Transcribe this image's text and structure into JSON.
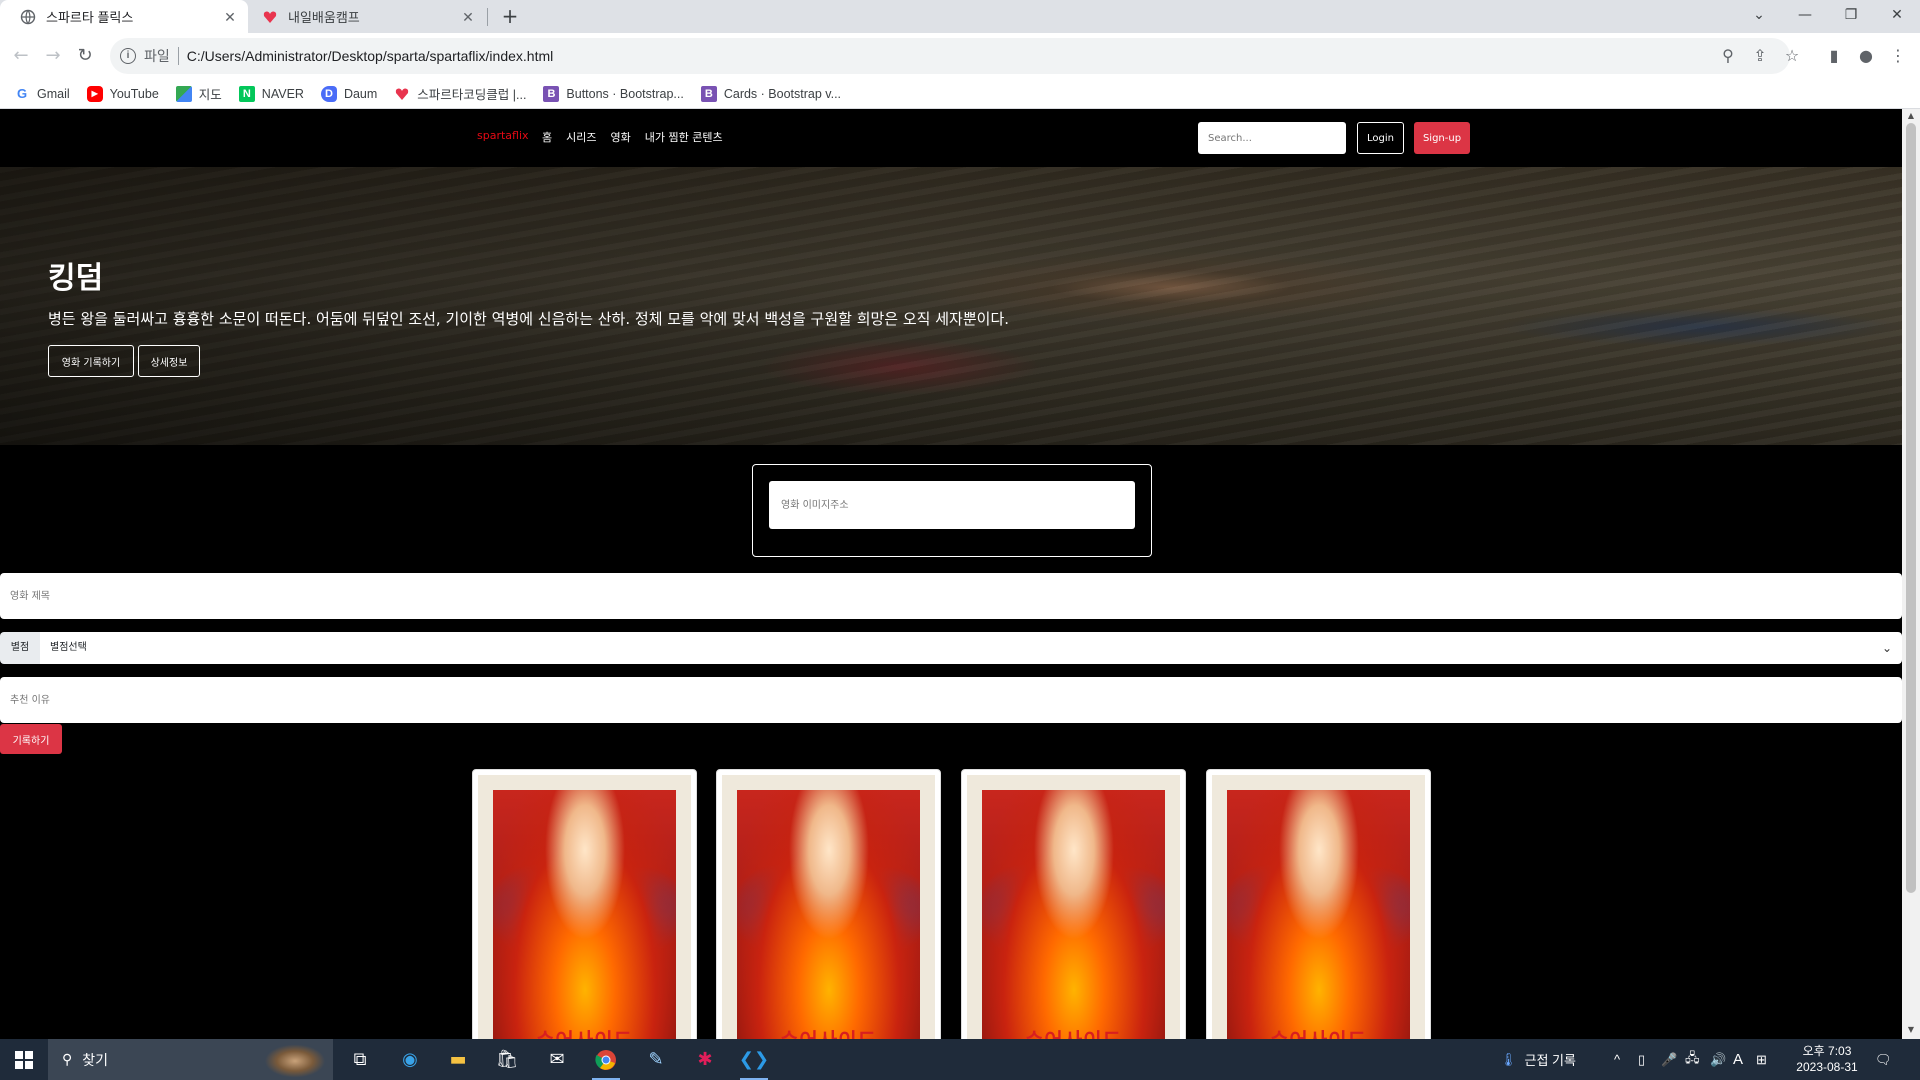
{
  "browser": {
    "tabs": [
      {
        "title": "스파르타 플릭스",
        "active": true
      },
      {
        "title": "내일배움캠프",
        "active": false
      }
    ],
    "scheme_label": "파일",
    "url": "C:/Users/Administrator/Desktop/sparta/spartaflix/index.html",
    "bookmarks": [
      {
        "label": "Gmail",
        "icon": "gmail-icon"
      },
      {
        "label": "YouTube",
        "icon": "youtube-icon"
      },
      {
        "label": "지도",
        "icon": "maps-icon"
      },
      {
        "label": "NAVER",
        "icon": "naver-icon"
      },
      {
        "label": "Daum",
        "icon": "daum-icon"
      },
      {
        "label": "스파르타코딩클럽 |...",
        "icon": "sparta-icon"
      },
      {
        "label": "Buttons · Bootstrap...",
        "icon": "bootstrap-icon"
      },
      {
        "label": "Cards · Bootstrap v...",
        "icon": "bootstrap-icon"
      }
    ]
  },
  "site": {
    "brand": "spartaflix",
    "nav": [
      "홈",
      "시리즈",
      "영화",
      "내가 찜한 콘텐츠"
    ],
    "search_placeholder": "Search...",
    "login_label": "Login",
    "signup_label": "Sign-up",
    "accent_color": "#dc3545"
  },
  "hero": {
    "title": "킹덤",
    "description": "병든 왕을 둘러싸고 흉흉한 소문이 떠돈다. 어둠에 뒤덮인 조선, 기이한 역병에 신음하는 산하. 정체 모를 악에 맞서 백성을 구원할 희망은 오직 세자뿐이다.",
    "record_button": "영화 기록하기",
    "detail_button": "상세정보"
  },
  "form": {
    "image_url_placeholder": "영화 이미지주소",
    "title_placeholder": "영화 제목",
    "star_label": "별점",
    "star_selected": "별점선택",
    "reason_placeholder": "추천 이유",
    "submit_label": "기록하기"
  },
  "cards": [
    {
      "poster_title": "수어사이드"
    },
    {
      "poster_title": "수어사이드"
    },
    {
      "poster_title": "수어사이드"
    },
    {
      "poster_title": "수어사이드"
    }
  ],
  "taskbar": {
    "search_placeholder": "찾기",
    "tray_text": "근접 기록",
    "ime_label": "A",
    "clock_time": "오후 7:03",
    "clock_date": "2023-08-31"
  }
}
